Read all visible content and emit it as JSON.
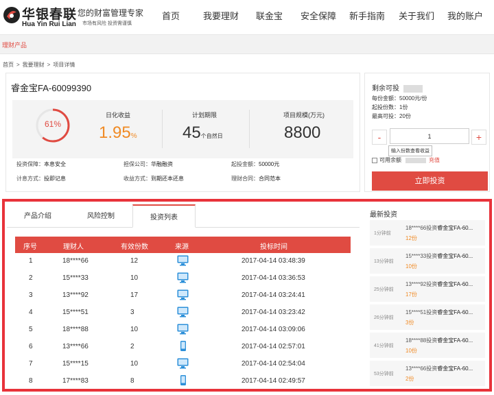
{
  "header": {
    "logo_cn": "华银春联",
    "logo_en": "Hua Yin Rui Lian",
    "slogan": "您的财富管理专家",
    "slogan_sub": "市场有风险  投资需谨慎",
    "nav": [
      "首页",
      "我要理财",
      "联金宝",
      "安全保障",
      "新手指南",
      "关于我们",
      "我的账户"
    ]
  },
  "subnav": {
    "item": "理财产品"
  },
  "breadcrumb": [
    "首页",
    ">",
    "我要理财",
    ">",
    "项目详情"
  ],
  "product": {
    "title": "睿金宝FA-60099390",
    "progress": "61%",
    "progress_value": 0.61,
    "rate_label": "日化收益",
    "rate_value": "1.95",
    "rate_unit": "%",
    "term_label": "计划期限",
    "term_value": "45",
    "term_unit": "个自然日",
    "scale_label": "项目规模(万元)",
    "scale_value": "8800",
    "info": [
      [
        "投资保障：",
        "本息安全"
      ],
      [
        "担保公司：",
        "华融融资"
      ],
      [
        "起投金额：",
        "50000元"
      ],
      [
        "计息方式：",
        "投即记息"
      ],
      [
        "收益方式：",
        "到期还本还息"
      ],
      [
        "理财合同：",
        "合同范本"
      ]
    ]
  },
  "buy": {
    "remaining_label": "剩余可投",
    "per_share": "每份金额：50000元/份",
    "min_shares": "起投份数：1份",
    "max_shares": "最高可投：20份",
    "minus": "-",
    "plus": "+",
    "qty": "1",
    "tip": "输入份数查看收益",
    "avail_label": "可用余额",
    "recharge": "充值",
    "button": "立即投资"
  },
  "tabs": [
    "产品介绍",
    "风险控制",
    "投资列表"
  ],
  "table": {
    "headers": [
      "序号",
      "理财人",
      "有效份数",
      "来源",
      "投标时间"
    ],
    "rows": [
      {
        "no": "1",
        "user": "18****66",
        "shares": "12",
        "source": "pc",
        "time": "2017-04-14 03:48:39"
      },
      {
        "no": "2",
        "user": "15****33",
        "shares": "10",
        "source": "pc",
        "time": "2017-04-14 03:36:53"
      },
      {
        "no": "3",
        "user": "13****92",
        "shares": "17",
        "source": "pc",
        "time": "2017-04-14 03:24:41"
      },
      {
        "no": "4",
        "user": "15****51",
        "shares": "3",
        "source": "pc",
        "time": "2017-04-14 03:23:42"
      },
      {
        "no": "5",
        "user": "18****88",
        "shares": "10",
        "source": "pc",
        "time": "2017-04-14 03:09:06"
      },
      {
        "no": "6",
        "user": "13****66",
        "shares": "2",
        "source": "mobile",
        "time": "2017-04-14 02:57:01"
      },
      {
        "no": "7",
        "user": "15****15",
        "shares": "10",
        "source": "pc",
        "time": "2017-04-14 02:54:04"
      },
      {
        "no": "8",
        "user": "17****83",
        "shares": "8",
        "source": "mobile",
        "time": "2017-04-14 02:49:57"
      }
    ]
  },
  "latest": {
    "title": "最新投资",
    "items": [
      {
        "ago": "1分钟前",
        "desc": "18****66投资",
        "prod": "睿金宝FA-60...",
        "amount": "12份"
      },
      {
        "ago": "13分钟前",
        "desc": "15****33投资",
        "prod": "睿金宝FA-60...",
        "amount": "10份"
      },
      {
        "ago": "25分钟前",
        "desc": "13****92投资",
        "prod": "睿金宝FA-60...",
        "amount": "17份"
      },
      {
        "ago": "26分钟前",
        "desc": "15****51投资",
        "prod": "睿金宝FA-60...",
        "amount": "3份"
      },
      {
        "ago": "41分钟前",
        "desc": "18****88投资",
        "prod": "睿金宝FA-60...",
        "amount": "10份"
      },
      {
        "ago": "53分钟前",
        "desc": "13****66投资",
        "prod": "睿金宝FA-60...",
        "amount": "2份"
      }
    ]
  },
  "colors": {
    "accent": "#e04b42",
    "orange": "#f08a24",
    "highlight_box": "#e8323a"
  }
}
